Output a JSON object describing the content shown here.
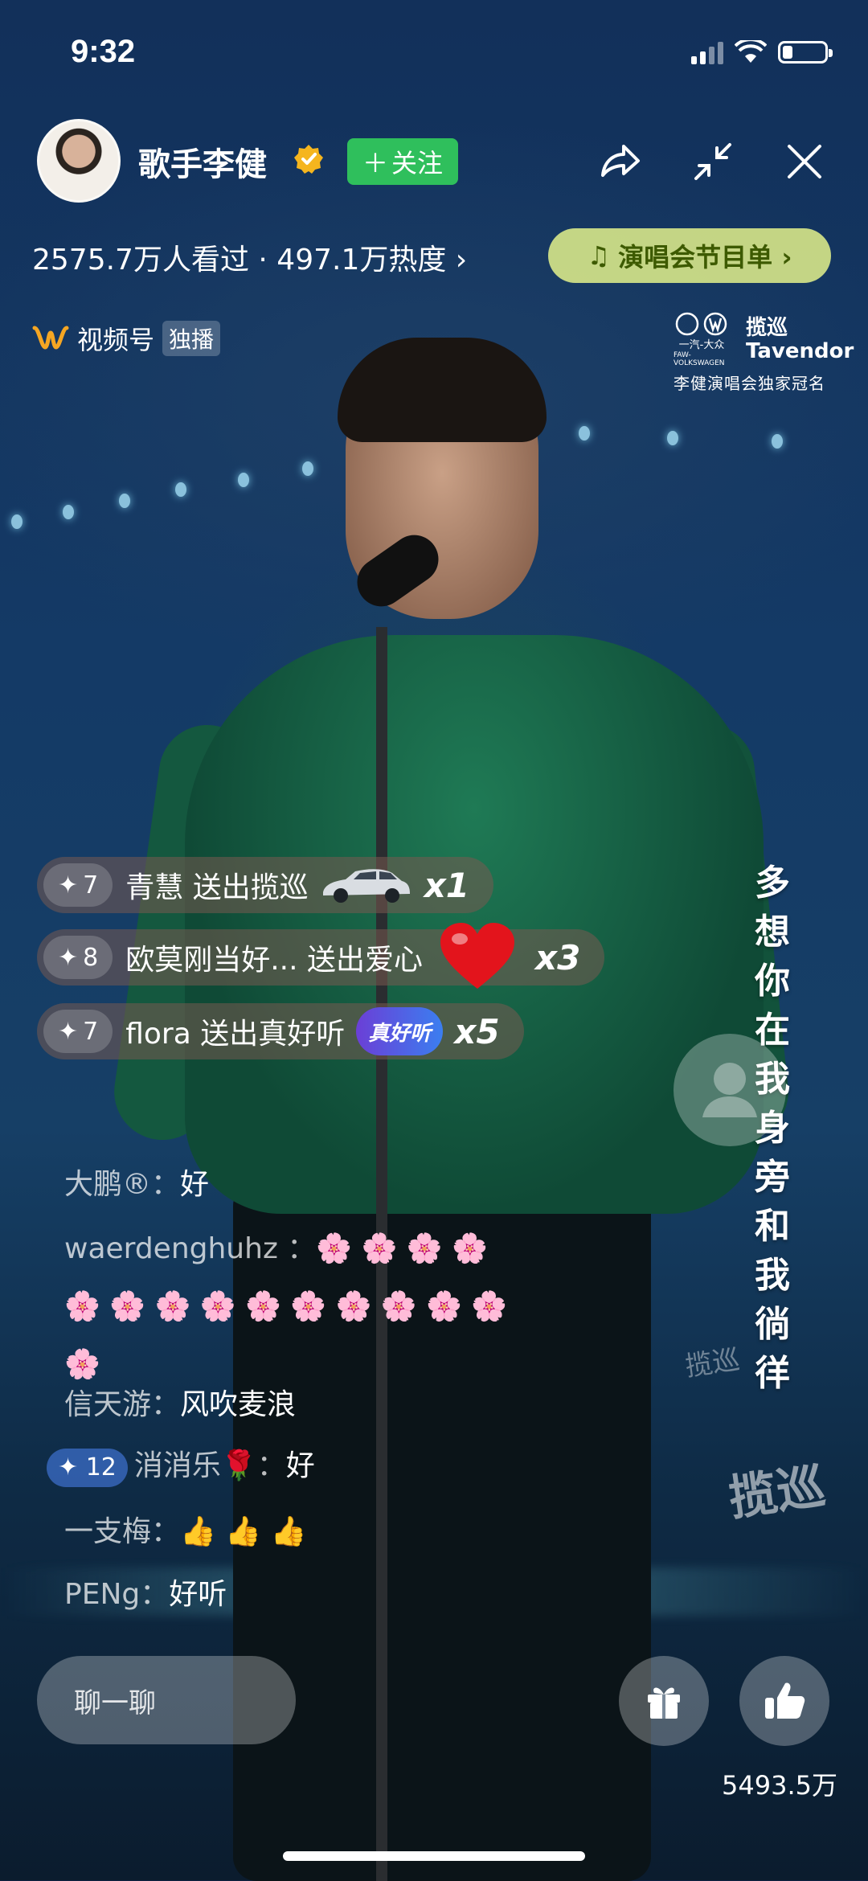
{
  "status_bar": {
    "time": "9:32"
  },
  "header": {
    "name": "歌手李健",
    "follow_label": "关注",
    "follow_plus": "＋",
    "stats": "2575.7万人看过 · 497.1万热度 ›",
    "program_label": "演唱会节目单 ›",
    "channel_label": "视频号",
    "exclusive_label": "独播"
  },
  "sponsor": {
    "brand1": "一汽-大众",
    "brand1_sub": "FAW-VOLKSWAGEN",
    "brand2_cn": "揽巡",
    "brand2_en": "Tavendor",
    "tagline": "李健演唱会独家冠名"
  },
  "gifts": [
    {
      "level": "7",
      "user": "青慧",
      "action": "送出揽巡",
      "count": "x1",
      "icon": "car-icon"
    },
    {
      "level": "8",
      "user": "欧莫刚当好...",
      "action": "送出爱心",
      "count": "x3",
      "icon": "heart-icon"
    },
    {
      "level": "7",
      "user": "flora",
      "action": "送出真好听",
      "count": "x5",
      "icon": "sticker-icon",
      "sticker_text": "真好听"
    }
  ],
  "lyric": [
    "多",
    "想",
    "你",
    "在",
    "我",
    "身",
    "旁",
    "和",
    "我",
    "徜",
    "徉"
  ],
  "comments": [
    {
      "user": "大鹏",
      "user_suffix": "®",
      "text": "好"
    },
    {
      "user": "waerdenghuhz",
      "text": "🌸 🌸 🌸 🌸",
      "line2": "🌸 🌸 🌸 🌸 🌸 🌸 🌸 🌸 🌸 🌸",
      "line3": "🌸"
    },
    {
      "user": "信天游",
      "text": "风吹麦浪"
    },
    {
      "level": "12",
      "user": "消消乐",
      "user_emoji": "🌹",
      "text": "好"
    },
    {
      "user": "一支梅",
      "text": "👍 👍 👍"
    },
    {
      "user": "PENg",
      "text": "好听"
    }
  ],
  "bottom": {
    "chat_placeholder": "聊一聊",
    "like_count": "5493.5万"
  },
  "watermark": "揽巡",
  "colors": {
    "follow_green": "#2fbf5c",
    "program_yellow": "#dded8a",
    "verified_gold": "#f5b51e"
  }
}
